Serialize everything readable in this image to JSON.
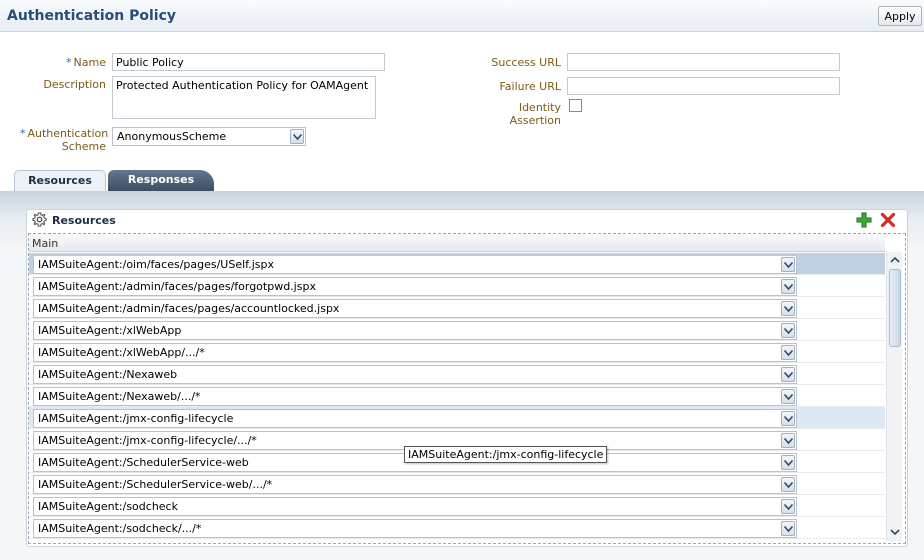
{
  "header": {
    "title": "Authentication Policy",
    "apply_label": "Apply"
  },
  "form": {
    "name_label": "Name",
    "name_value": "Public Policy",
    "description_label": "Description",
    "description_value": "Protected Authentication Policy for OAMAgent",
    "auth_scheme_label_1": "Authentication",
    "auth_scheme_label_2": "Scheme",
    "auth_scheme_value": "AnonymousScheme",
    "success_url_label": "Success URL",
    "success_url_value": "",
    "failure_url_label": "Failure URL",
    "failure_url_value": "",
    "identity_label_1": "Identity",
    "identity_label_2": "Assertion",
    "identity_checked": false
  },
  "tabs": [
    {
      "label": "Resources",
      "active": true
    },
    {
      "label": "Responses",
      "active": false
    }
  ],
  "resources": {
    "title": "Resources",
    "column_header": "Main",
    "rows": [
      "IAMSuiteAgent:/oim/faces/pages/USelf.jspx",
      "IAMSuiteAgent:/admin/faces/pages/forgotpwd.jspx",
      "IAMSuiteAgent:/admin/faces/pages/accountlocked.jspx",
      "IAMSuiteAgent:/xlWebApp",
      "IAMSuiteAgent:/xlWebApp/.../*",
      "IAMSuiteAgent:/Nexaweb",
      "IAMSuiteAgent:/Nexaweb/.../*",
      "IAMSuiteAgent:/jmx-config-lifecycle",
      "IAMSuiteAgent:/jmx-config-lifecycle/.../*",
      "IAMSuiteAgent:/SchedulerService-web",
      "IAMSuiteAgent:/SchedulerService-web/.../*",
      "IAMSuiteAgent:/sodcheck",
      "IAMSuiteAgent:/sodcheck/.../*"
    ],
    "selected_row": 0,
    "hovered_row": 7
  },
  "tooltip": {
    "text": "IAMSuiteAgent:/jmx-config-lifecycle"
  },
  "colors": {
    "title": "#294c7a",
    "label": "#7c5a16",
    "add": "#2e9a2e",
    "delete": "#cc2222",
    "selected_row": "#c0d0e2"
  }
}
